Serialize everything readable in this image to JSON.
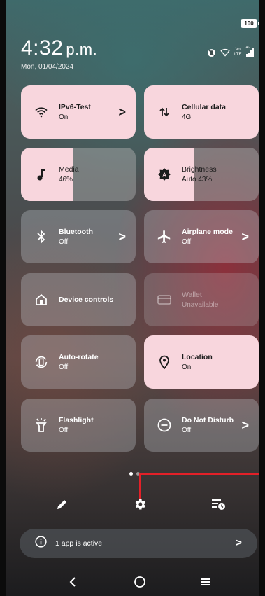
{
  "status_bar": {
    "battery": "100",
    "time": "4:32",
    "ampm": "p.m.",
    "date": "Mon, 01/04/2024",
    "network_label_top": "Vo",
    "network_label_bottom": "LTE",
    "network_gen": "4G"
  },
  "tiles": [
    {
      "title": "IPv6-Test",
      "subtitle": "On",
      "icon": "wifi-icon",
      "state": "on",
      "chevron": ">"
    },
    {
      "title": "Cellular data",
      "subtitle": "4G",
      "icon": "cellular-data-icon",
      "state": "on"
    },
    {
      "title": "Media",
      "subtitle": "46%",
      "icon": "music-note-icon",
      "state": "slider",
      "level_percent": 46
    },
    {
      "title": "Brightness",
      "subtitle": "Auto 43%",
      "icon": "brightness-auto-icon",
      "state": "slider",
      "level_percent": 43
    },
    {
      "title": "Bluetooth",
      "subtitle": "Off",
      "icon": "bluetooth-icon",
      "state": "off",
      "chevron": ">"
    },
    {
      "title": "Airplane mode",
      "subtitle": "Off",
      "icon": "airplane-icon",
      "state": "off",
      "chevron": ">"
    },
    {
      "title": "Device controls",
      "subtitle": "",
      "icon": "home-icon",
      "state": "off"
    },
    {
      "title": "Wallet",
      "subtitle": "Unavailable",
      "icon": "wallet-icon",
      "state": "disabled"
    },
    {
      "title": "Auto-rotate",
      "subtitle": "Off",
      "icon": "auto-rotate-icon",
      "state": "off"
    },
    {
      "title": "Location",
      "subtitle": "On",
      "icon": "location-icon",
      "state": "on"
    },
    {
      "title": "Flashlight",
      "subtitle": "Off",
      "icon": "flashlight-icon",
      "state": "off"
    },
    {
      "title": "Do Not Disturb",
      "subtitle": "Off",
      "icon": "do-not-disturb-icon",
      "state": "off",
      "chevron": ">"
    }
  ],
  "pager": {
    "pages": 2,
    "current": 1
  },
  "actions": [
    "edit-icon",
    "settings-icon",
    "alarm-list-icon"
  ],
  "active_apps": {
    "text": "1 app is active",
    "chevron": ">"
  },
  "nav": {
    "back": "<",
    "home": "○",
    "recents": "≡"
  },
  "colors": {
    "tile_on": "#f8d6dd",
    "annotation": "#e32028"
  }
}
